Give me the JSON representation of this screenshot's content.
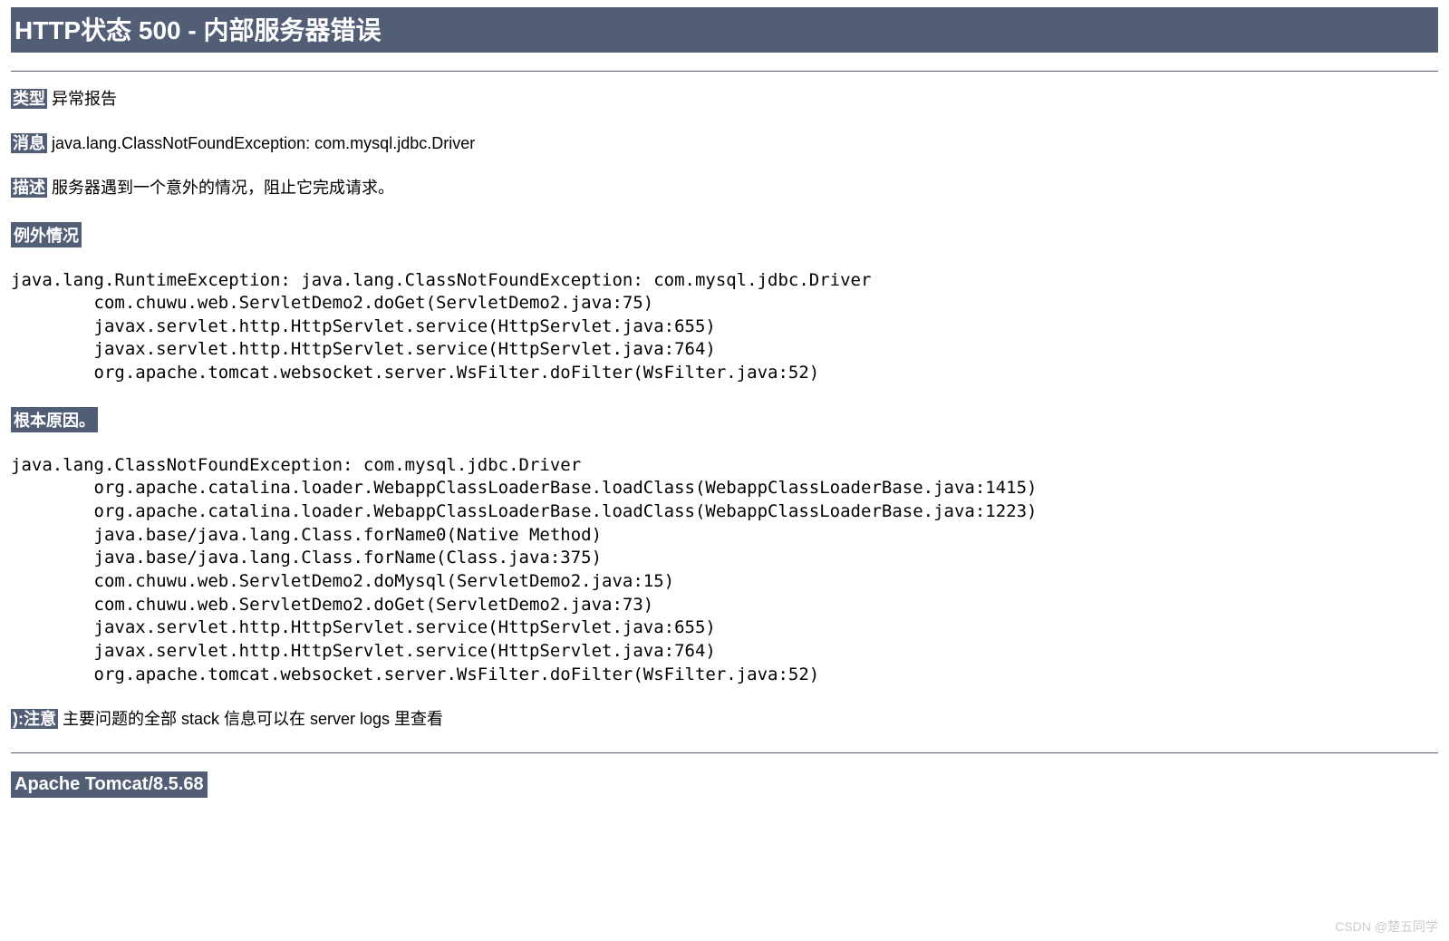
{
  "title": "HTTP状态 500 - 内部服务器错误",
  "rows": {
    "type": {
      "label": "类型",
      "value": "异常报告"
    },
    "message": {
      "label": "消息",
      "value": "java.lang.ClassNotFoundException: com.mysql.jdbc.Driver"
    },
    "description": {
      "label": "描述",
      "value": "服务器遇到一个意外的情况，阻止它完成请求。"
    }
  },
  "sections": {
    "exception": {
      "heading": "例外情况",
      "trace": "java.lang.RuntimeException: java.lang.ClassNotFoundException: com.mysql.jdbc.Driver\n\tcom.chuwu.web.ServletDemo2.doGet(ServletDemo2.java:75)\n\tjavax.servlet.http.HttpServlet.service(HttpServlet.java:655)\n\tjavax.servlet.http.HttpServlet.service(HttpServlet.java:764)\n\torg.apache.tomcat.websocket.server.WsFilter.doFilter(WsFilter.java:52)"
    },
    "rootcause": {
      "heading": "根本原因。",
      "trace": "java.lang.ClassNotFoundException: com.mysql.jdbc.Driver\n\torg.apache.catalina.loader.WebappClassLoaderBase.loadClass(WebappClassLoaderBase.java:1415)\n\torg.apache.catalina.loader.WebappClassLoaderBase.loadClass(WebappClassLoaderBase.java:1223)\n\tjava.base/java.lang.Class.forName0(Native Method)\n\tjava.base/java.lang.Class.forName(Class.java:375)\n\tcom.chuwu.web.ServletDemo2.doMysql(ServletDemo2.java:15)\n\tcom.chuwu.web.ServletDemo2.doGet(ServletDemo2.java:73)\n\tjavax.servlet.http.HttpServlet.service(HttpServlet.java:655)\n\tjavax.servlet.http.HttpServlet.service(HttpServlet.java:764)\n\torg.apache.tomcat.websocket.server.WsFilter.doFilter(WsFilter.java:52)"
    }
  },
  "note": {
    "label": "):注意",
    "value": "主要问题的全部 stack 信息可以在 server logs 里查看"
  },
  "footer": "Apache Tomcat/8.5.68",
  "watermark": "CSDN @楚五同学"
}
